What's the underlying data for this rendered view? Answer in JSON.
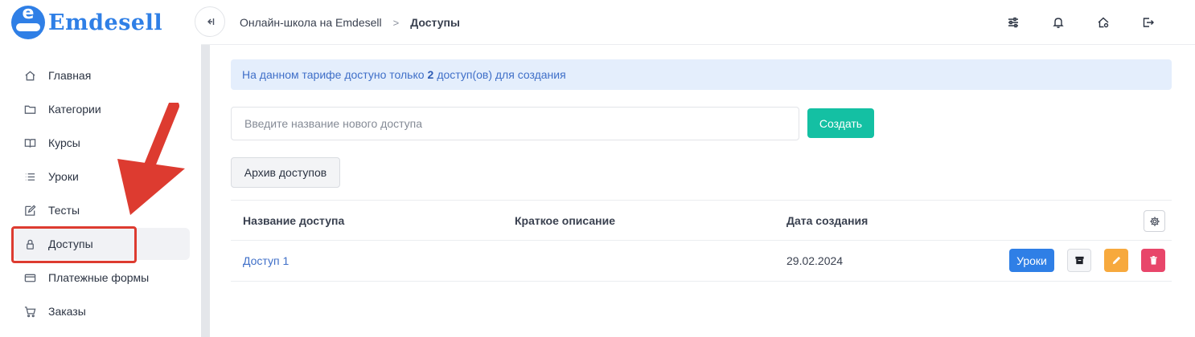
{
  "brand": {
    "name": "Emdesell",
    "logo_letter": "e"
  },
  "sidebar": {
    "items": [
      {
        "label": "Главная",
        "icon": "home-icon"
      },
      {
        "label": "Категории",
        "icon": "folder-icon"
      },
      {
        "label": "Курсы",
        "icon": "book-icon"
      },
      {
        "label": "Уроки",
        "icon": "list-icon"
      },
      {
        "label": "Тесты",
        "icon": "edit-icon"
      },
      {
        "label": "Доступы",
        "icon": "lock-icon",
        "active": true
      },
      {
        "label": "Платежные формы",
        "icon": "credit-card-icon"
      },
      {
        "label": "Заказы",
        "icon": "cart-icon"
      }
    ]
  },
  "breadcrumb": {
    "parent": "Онлайн-школа на Emdesell",
    "separator": ">",
    "current": "Доступы"
  },
  "topbar_icons": [
    "sliders-icon",
    "bell-icon",
    "home-settings-icon",
    "logout-icon"
  ],
  "alert": {
    "prefix": "На данном тарифе достуно только",
    "count": "2",
    "suffix": "доступ(ов) для создания"
  },
  "form": {
    "placeholder": "Введите название нового доступа",
    "value": "",
    "create_label": "Создать"
  },
  "archive_label": "Архив доступов",
  "table": {
    "columns": [
      "Название доступа",
      "Краткое описание",
      "Дата создания"
    ],
    "rows": [
      {
        "name": "Доступ 1",
        "description": "",
        "created": "29.02.2024",
        "lessons_label": "Уроки"
      }
    ]
  },
  "colors": {
    "primary": "#2f7fe6",
    "create": "#14c0a3",
    "edit": "#f7a93d",
    "delete": "#e8466a",
    "annotation": "#dd3b30"
  }
}
